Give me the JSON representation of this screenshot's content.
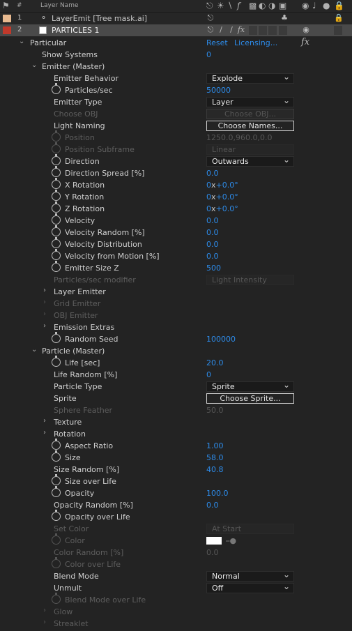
{
  "header": {
    "num_label": "#",
    "layer_name_label": "Layer Name"
  },
  "layers": [
    {
      "num": "1",
      "name": "LayerEmit [Tree mask.ai]",
      "label_color": "#e8b98f"
    },
    {
      "num": "2",
      "name": "PARTICLES 1",
      "label_color": "#c0392b"
    }
  ],
  "effect": {
    "name": "Particular",
    "reset": "Reset",
    "licensing": "Licensing...",
    "fx": "fx"
  },
  "props": {
    "show_systems": {
      "label": "Show Systems",
      "value": "0"
    },
    "emitter_master": "Emitter (Master)",
    "emitter_behavior": {
      "label": "Emitter Behavior",
      "value": "Explode"
    },
    "particles_sec": {
      "label": "Particles/sec",
      "value": "50000"
    },
    "emitter_type": {
      "label": "Emitter Type",
      "value": "Layer"
    },
    "choose_obj": {
      "label": "Choose OBJ",
      "button": "Choose OBJ..."
    },
    "light_naming": {
      "label": "Light Naming",
      "button": "Choose Names..."
    },
    "position": {
      "label": "Position",
      "value": "1250.0,960.0,0.0"
    },
    "position_subframe": {
      "label": "Position Subframe",
      "value": "Linear"
    },
    "direction": {
      "label": "Direction",
      "value": "Outwards"
    },
    "direction_spread": {
      "label": "Direction Spread [%]",
      "value": "0.0"
    },
    "x_rotation": {
      "label": "X Rotation",
      "rev": "0",
      "sep": "x",
      "deg": "+0.0°"
    },
    "y_rotation": {
      "label": "Y Rotation",
      "rev": "0",
      "sep": "x",
      "deg": "+0.0°"
    },
    "z_rotation": {
      "label": "Z Rotation",
      "rev": "0",
      "sep": "x",
      "deg": "+0.0°"
    },
    "velocity": {
      "label": "Velocity",
      "value": "0.0"
    },
    "velocity_random": {
      "label": "Velocity Random [%]",
      "value": "0.0"
    },
    "velocity_distribution": {
      "label": "Velocity Distribution",
      "value": "0.0"
    },
    "velocity_from_motion": {
      "label": "Velocity from Motion [%]",
      "value": "0.0"
    },
    "emitter_size_z": {
      "label": "Emitter Size Z",
      "value": "500"
    },
    "particles_sec_modifier": {
      "label": "Particles/sec modifier",
      "value": "Light Intensity"
    },
    "layer_emitter": "Layer Emitter",
    "grid_emitter": "Grid Emitter",
    "obj_emitter": "OBJ Emitter",
    "emission_extras": "Emission Extras",
    "random_seed": {
      "label": "Random Seed",
      "value": "100000"
    },
    "particle_master": "Particle (Master)",
    "life": {
      "label": "Life [sec]",
      "value": "20.0"
    },
    "life_random": {
      "label": "Life Random [%]",
      "value": "0"
    },
    "particle_type": {
      "label": "Particle Type",
      "value": "Sprite"
    },
    "sprite": {
      "label": "Sprite",
      "button": "Choose Sprite..."
    },
    "sphere_feather": {
      "label": "Sphere Feather",
      "value": "50.0"
    },
    "texture": "Texture",
    "rotation": "Rotation",
    "aspect_ratio": {
      "label": "Aspect Ratio",
      "value": "1.00"
    },
    "size": {
      "label": "Size",
      "value": "58.0"
    },
    "size_random": {
      "label": "Size Random [%]",
      "value": "40.8"
    },
    "size_over_life": {
      "label": "Size over Life"
    },
    "opacity": {
      "label": "Opacity",
      "value": "100.0"
    },
    "opacity_random": {
      "label": "Opacity Random [%]",
      "value": "0.0"
    },
    "opacity_over_life": {
      "label": "Opacity over Life"
    },
    "set_color": {
      "label": "Set Color",
      "value": "At Start"
    },
    "color": {
      "label": "Color",
      "swatch": "#ffffff"
    },
    "color_random": {
      "label": "Color Random [%]",
      "value": "0.0"
    },
    "color_over_life": {
      "label": "Color over Life"
    },
    "blend_mode": {
      "label": "Blend Mode",
      "value": "Normal"
    },
    "unmult": {
      "label": "Unmult",
      "value": "Off"
    },
    "blend_mode_over_life": {
      "label": "Blend Mode over Life"
    },
    "glow": "Glow",
    "streaklet": "Streaklet"
  },
  "colors": {
    "value_blue": "#2d8ceb",
    "panel_bg": "#232323",
    "selected_row": "#4a4a4a"
  }
}
